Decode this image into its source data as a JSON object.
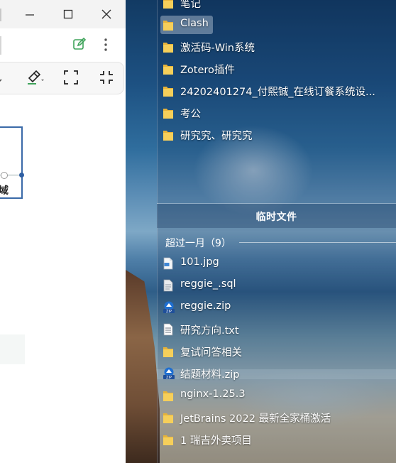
{
  "fence": {
    "top_items": [
      {
        "label": "笔记",
        "icon": "folder-icon"
      },
      {
        "label": "Clash",
        "icon": "folder-icon",
        "selected": true
      },
      {
        "label": "激活码-Win系统",
        "icon": "folder-icon"
      },
      {
        "label": "Zotero插件",
        "icon": "folder-icon"
      },
      {
        "label": "24202401274_付熙铖_在线订餐系统设...",
        "icon": "folder-icon"
      },
      {
        "label": "考公",
        "icon": "folder-icon"
      },
      {
        "label": "研究究、研究究",
        "icon": "folder-icon"
      }
    ],
    "title": "临时文件",
    "group_header": "超过一月（9）",
    "group_items": [
      {
        "label": "101.jpg",
        "icon": "image-file-icon"
      },
      {
        "label": "reggie_.sql",
        "icon": "sql-file-icon"
      },
      {
        "label": "reggie.zip",
        "icon": "zip-file-icon"
      },
      {
        "label": "研究方向.txt",
        "icon": "text-file-icon"
      },
      {
        "label": "复试问答相关",
        "icon": "folder-icon"
      },
      {
        "label": "结题材料.zip",
        "icon": "zip-file-icon"
      },
      {
        "label": "nginx-1.25.3",
        "icon": "folder-icon"
      },
      {
        "label": "JetBrains  2022 最新全家桶激活",
        "icon": "folder-icon"
      },
      {
        "label": "1 瑞吉外卖项目",
        "icon": "folder-icon"
      }
    ]
  },
  "app": {
    "diagram_node_text": "域",
    "accent_color": "#3a6aa8",
    "edit_icon_color": "#3ea35a"
  }
}
